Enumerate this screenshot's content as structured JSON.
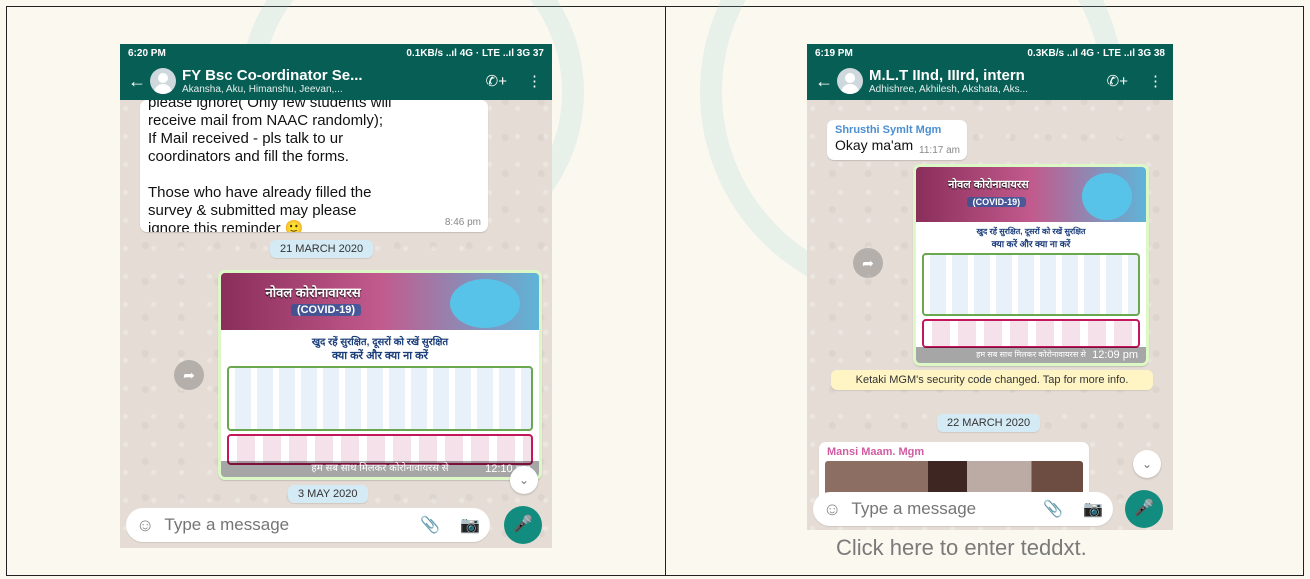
{
  "left": {
    "status": {
      "time": "6:20 PM",
      "net": "0.1KB/s ..ıl 4G · LTE ..ıl 3G 37"
    },
    "header": {
      "title": "FY Bsc Co-ordinator Se...",
      "subtitle": "Akansha, Aku, Himanshu, Jeevan,..."
    },
    "message": {
      "text": "please ignore( Only few students will\nreceive mail from NAAC randomly);\nIf Mail received - pls talk to ur\ncoordinators and fill the forms.\n\nThose who have already filled the\nsurvey & submitted may please\nignore this reminder 🙂",
      "time": "8:46 pm"
    },
    "date1": "21 MARCH 2020",
    "poster": {
      "title": "नोवल कोरोनावायरस",
      "subtitle": "(COVID-19)",
      "slogan": "खुद रहें सुरक्षित, दूसरों को रखें सुरक्षित",
      "dos": "क्या करें और क्या ना करें",
      "footer": "हम सब साथ मिलकर कोरोनावायरस से",
      "time": "12:10 pm"
    },
    "date2": "3 MAY 2020",
    "input_placeholder": "Type a message"
  },
  "right": {
    "status": {
      "time": "6:19 PM",
      "net": "0.3KB/s ..ıl 4G · LTE ..ıl 3G 38"
    },
    "header": {
      "title": "M.L.T IInd, IIIrd, intern",
      "subtitle": "Adhishree, Akhilesh, Akshata, Aks..."
    },
    "message": {
      "sender": "Shrusthi Symlt Mgm",
      "text": "Okay ma'am",
      "time": "11:17 am"
    },
    "poster": {
      "title": "नोवल कोरोनावायरस",
      "subtitle": "(COVID-19)",
      "slogan": "खुद रहें सुरक्षित, दूसरों को रखें सुरक्षित",
      "dos": "क्या करें और क्या ना करें",
      "footer": "हम सब साथ मिलकर कोरोनावायरस से",
      "time": "12:09 pm"
    },
    "security_notice": "Ketaki MGM's security code changed. Tap for more info.",
    "date": "22 MARCH 2020",
    "photo_sender": "Mansi Maam. Mgm",
    "input_placeholder": "Type a message"
  },
  "caption": "Click here to enter teddxt.",
  "colors": {
    "header": "#075e54",
    "mic": "#128c7e",
    "date_chip": "#d4eaf4",
    "notice": "#fff5c4"
  }
}
